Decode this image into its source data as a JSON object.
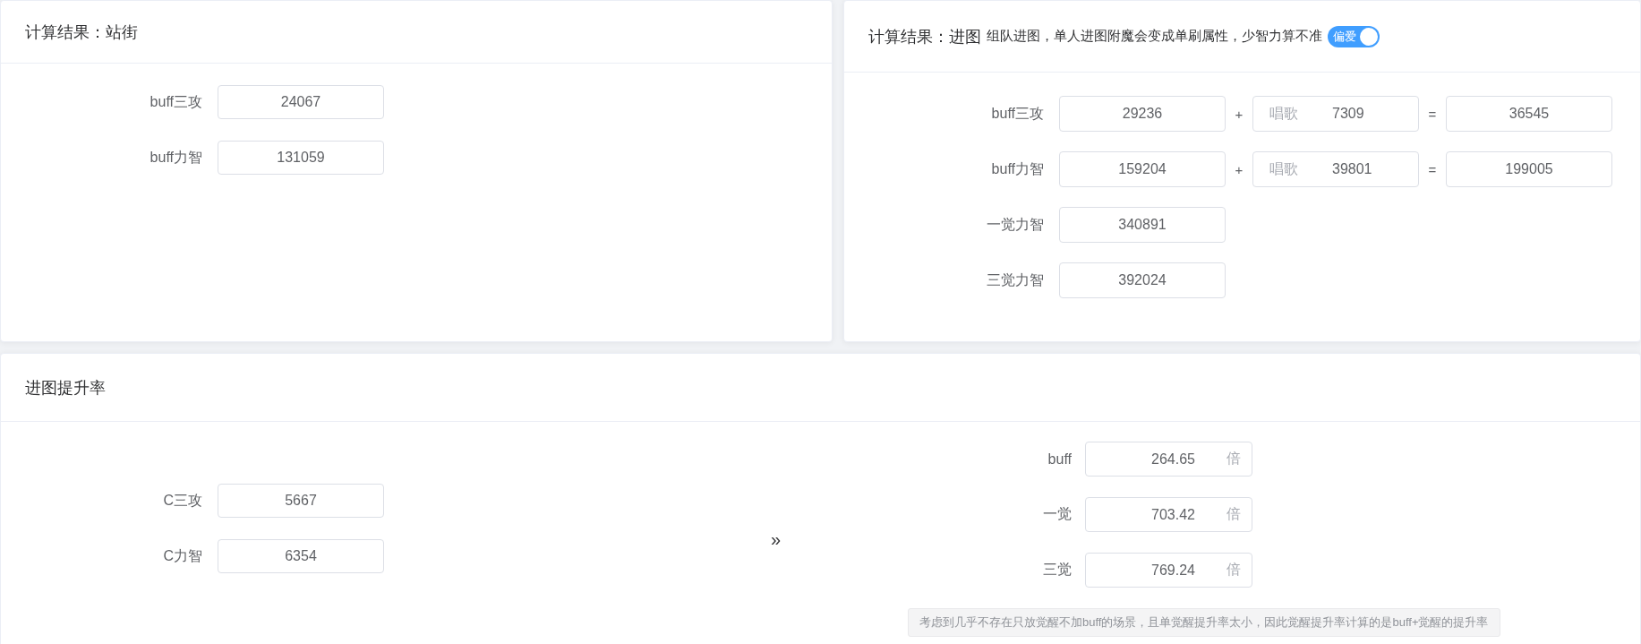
{
  "standing": {
    "title": "计算结果：站街",
    "rows": [
      {
        "label": "buff三攻",
        "value": "24067"
      },
      {
        "label": "buff力智",
        "value": "131059"
      }
    ]
  },
  "dungeon": {
    "title": "计算结果：进图",
    "note": "组队进图，单人进图附魔会变成单刷属性，少智力算不准",
    "toggle": {
      "label": "偏爱",
      "on": true
    },
    "rows": [
      {
        "label": "buff三攻",
        "value": "29236",
        "plus": "+",
        "song_label": "唱歌",
        "song_value": "7309",
        "equals": "=",
        "total": "36545"
      },
      {
        "label": "buff力智",
        "value": "159204",
        "plus": "+",
        "song_label": "唱歌",
        "song_value": "39801",
        "equals": "=",
        "total": "199005"
      },
      {
        "label": "一觉力智",
        "value": "340891"
      },
      {
        "label": "三觉力智",
        "value": "392024"
      }
    ]
  },
  "rate": {
    "title": "进图提升率",
    "inputs": [
      {
        "label": "C三攻",
        "value": "5667"
      },
      {
        "label": "C力智",
        "value": "6354"
      }
    ],
    "arrow": "»",
    "results": [
      {
        "label": "buff",
        "value": "264.65",
        "unit": "倍"
      },
      {
        "label": "一觉",
        "value": "703.42",
        "unit": "倍"
      },
      {
        "label": "三觉",
        "value": "769.24",
        "unit": "倍"
      }
    ],
    "tip": "考虑到几乎不存在只放觉醒不加buff的场景，且单觉醒提升率太小，因此觉醒提升率计算的是buff+觉醒的提升率"
  }
}
